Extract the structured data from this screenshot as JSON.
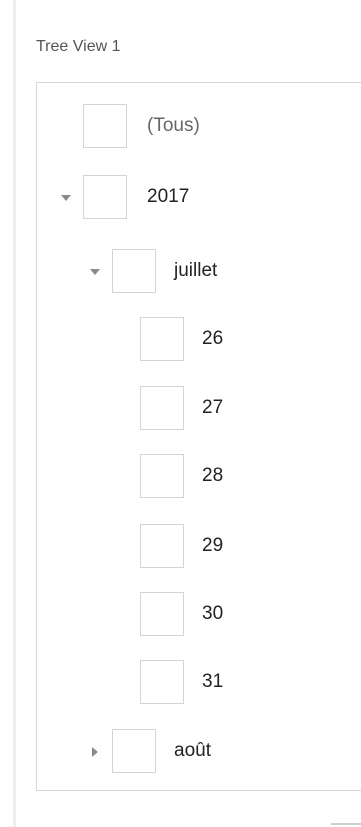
{
  "panel": {
    "title": "Tree View 1"
  },
  "tree": {
    "select_all_label": "(Tous)",
    "year": {
      "label": "2017",
      "expander": "chevron-down-icon",
      "months": [
        {
          "label": "juillet",
          "expander": "chevron-down-icon",
          "days": [
            "26",
            "27",
            "28",
            "29",
            "30",
            "31"
          ]
        },
        {
          "label": "août",
          "expander": "chevron-right-icon"
        }
      ]
    }
  },
  "colors": {
    "checkbox_border": "#d4d4d4",
    "expander_glyph": "#8a8a8a",
    "text": "#222222",
    "muted_text": "#666666"
  }
}
